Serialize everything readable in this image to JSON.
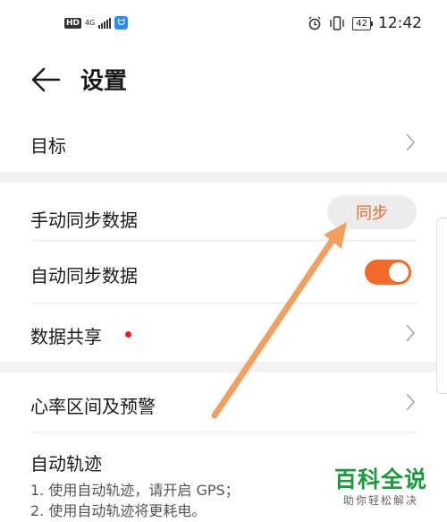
{
  "statusbar": {
    "hd": "HD",
    "net": "4G",
    "battery": "42",
    "time": "12:42"
  },
  "header": {
    "title": "设置"
  },
  "rows": {
    "goal": "目标",
    "manual_sync": "手动同步数据",
    "sync_button": "同步",
    "auto_sync": "自动同步数据",
    "auto_sync_on": true,
    "data_share": "数据共享",
    "heart_rate": "心率区间及预警",
    "auto_track": "自动轨迹",
    "auto_track_desc_1": "1. 使用自动轨迹，请开启 GPS；",
    "auto_track_desc_2": "2. 使用自动轨迹将更耗电。"
  },
  "colors": {
    "accent": "#f06a2a",
    "sync_text": "#e8692c",
    "annotation_arrow": "#f0a060",
    "red_dot": "#e02020",
    "watermark": "#1b9a3c"
  },
  "watermark": {
    "main": "百科全说",
    "sub": "助你轻松解决"
  }
}
